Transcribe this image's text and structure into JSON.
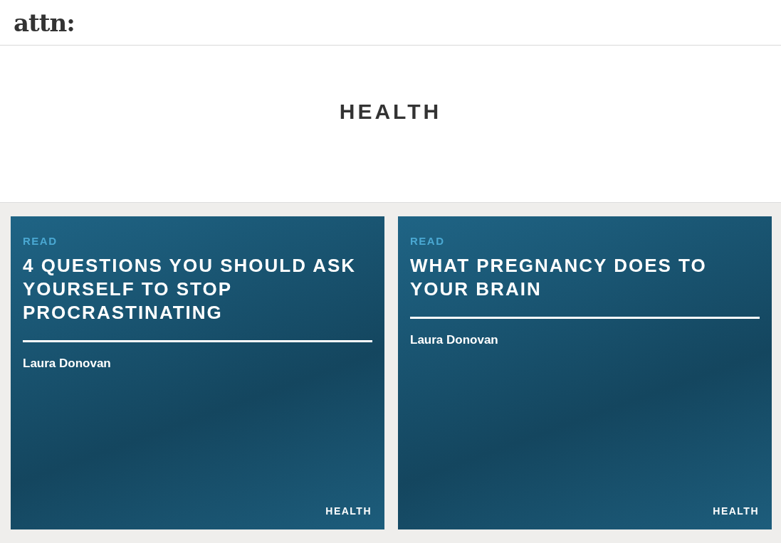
{
  "header": {
    "logo": "attn:"
  },
  "page_title": "HEALTH",
  "articles": [
    {
      "label": "READ",
      "title": "4 QUESTIONS YOU SHOULD ASK YOURSELF TO STOP PROCRASTINATING",
      "author": "Laura Donovan",
      "category": "HEALTH"
    },
    {
      "label": "READ",
      "title": "WHAT PREGNANCY DOES TO YOUR BRAIN",
      "author": "Laura Donovan",
      "category": "HEALTH"
    }
  ]
}
